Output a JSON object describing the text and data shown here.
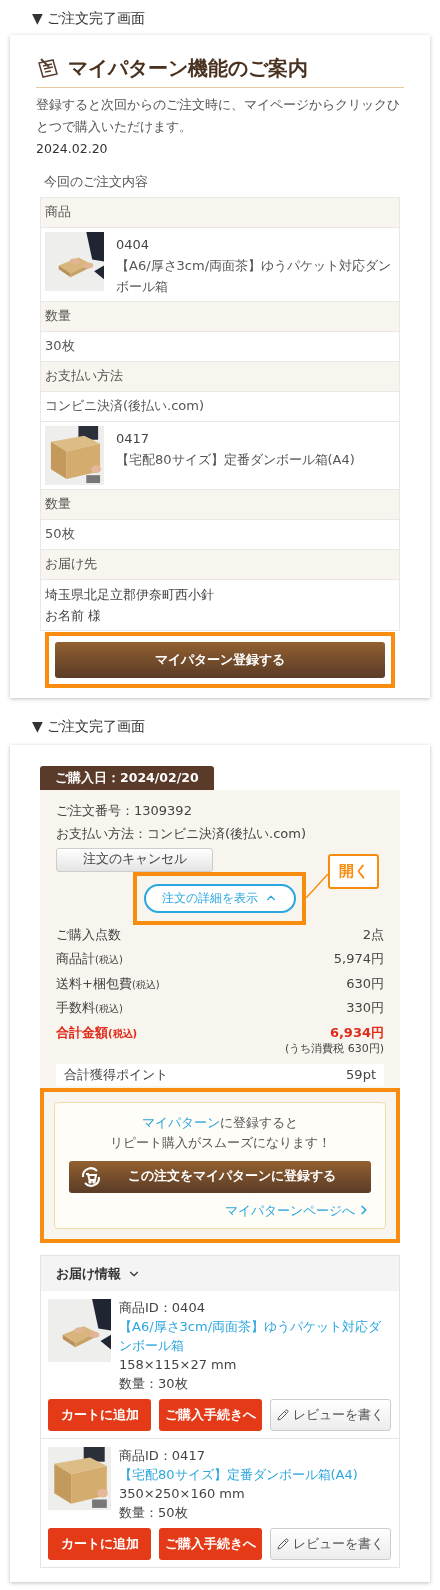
{
  "section_1": {
    "caption": "▼ ご注文完了画面",
    "title": "マイパターン機能のご案内",
    "description": "登録すると次回からのご注文時に、マイページからクリックひとつで購入いただけます。",
    "date": "2024.02.20",
    "table_caption": "今回のご注文内容",
    "rows": [
      {
        "kind": "header",
        "text": "商品"
      },
      {
        "kind": "product",
        "code": "0404",
        "name": "【A6/厚さ3cm/両面茶】ゆうパケット対応ダンボール箱"
      },
      {
        "kind": "header",
        "text": "数量"
      },
      {
        "kind": "value",
        "text": "30枚"
      },
      {
        "kind": "header",
        "text": "お支払い方法"
      },
      {
        "kind": "value",
        "text": "コンビニ決済(後払い.com)"
      },
      {
        "kind": "product",
        "code": "0417",
        "name": "【宅配80サイズ】定番ダンボール箱(A4)"
      },
      {
        "kind": "header",
        "text": "数量"
      },
      {
        "kind": "value",
        "text": "50枚"
      },
      {
        "kind": "header",
        "text": "お届け先"
      },
      {
        "kind": "address",
        "lines": [
          "埼玉県北足立郡伊奈町西小針",
          "お名前 様"
        ]
      }
    ],
    "register_button": {
      "label": "マイパターン登録する",
      "highlighted": true
    }
  },
  "section_2": {
    "caption": "▼ ご注文完了画面",
    "date_tab": "ご購入日：2024/02/20",
    "order_number": "ご注文番号：1309392",
    "payment": "お支払い方法：コンビニ決済(後払い.com)",
    "cancel_button": "注文のキャンセル",
    "details_toggle": {
      "label": "注文の詳細を表示",
      "expanded": true,
      "highlighted": true
    },
    "callout": "開く",
    "summary": [
      {
        "kind": "normal",
        "label": "ご購入点数",
        "value": "2点"
      },
      {
        "kind": "normal",
        "label": "商品計",
        "note": "(税込)",
        "value": "5,974円"
      },
      {
        "kind": "normal",
        "label": "送料+梱包費",
        "note": "(税込)",
        "value": "630円"
      },
      {
        "kind": "normal",
        "label": "手数料",
        "note": "(税込)",
        "value": "330円"
      },
      {
        "kind": "total",
        "label": "合計金額",
        "note": "(税込)",
        "value": "6,934円",
        "sub": "(うち消費税 630円)"
      }
    ],
    "points": {
      "label": "合計獲得ポイント",
      "value": "59pt"
    },
    "promo": {
      "highlighted": true,
      "link": "マイパターン",
      "text": "に登録すると",
      "line_2": "リピート購入がスムーズになります！",
      "button": "この注文をマイパターンに登録する",
      "page_link": "マイパターンページへ"
    },
    "delivery": {
      "title": "お届け情報",
      "expanded": false,
      "items": [
        {
          "id": "商品ID：0404",
          "name": "【A6/厚さ3cm/両面茶】ゆうパケット対応ダンボール箱",
          "size": "158×115×27 mm",
          "quantity": "数量：30枚",
          "buttons": [
            "カートに追加",
            "ご購入手続きへ",
            "レビューを書く"
          ]
        },
        {
          "id": "商品ID：0417",
          "name": "【宅配80サイズ】定番ダンボール箱(A4)",
          "size": "350×250×160 mm",
          "quantity": "数量：50枚",
          "buttons": [
            "カートに追加",
            "ご購入手続きへ",
            "レビューを書く"
          ]
        }
      ]
    }
  }
}
